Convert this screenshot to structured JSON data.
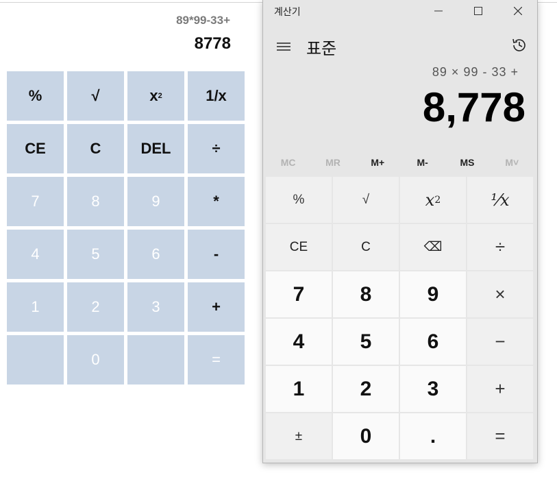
{
  "web_calc": {
    "expression": "89*99-33+",
    "result": "8778",
    "keys": [
      {
        "label": "%",
        "name": "key-percent",
        "type": "op"
      },
      {
        "label": "√",
        "name": "key-sqrt",
        "type": "op"
      },
      {
        "label": "x",
        "sup": "2",
        "name": "key-square",
        "type": "op"
      },
      {
        "label": "1/x",
        "name": "key-reciprocal",
        "type": "op"
      },
      {
        "label": "CE",
        "name": "key-clear-entry",
        "type": "op"
      },
      {
        "label": "C",
        "name": "key-clear",
        "type": "op"
      },
      {
        "label": "DEL",
        "name": "key-delete",
        "type": "op"
      },
      {
        "label": "÷",
        "name": "key-divide",
        "type": "op"
      },
      {
        "label": "7",
        "name": "key-7",
        "type": "num"
      },
      {
        "label": "8",
        "name": "key-8",
        "type": "num"
      },
      {
        "label": "9",
        "name": "key-9",
        "type": "num"
      },
      {
        "label": "*",
        "name": "key-multiply",
        "type": "op"
      },
      {
        "label": "4",
        "name": "key-4",
        "type": "num"
      },
      {
        "label": "5",
        "name": "key-5",
        "type": "num"
      },
      {
        "label": "6",
        "name": "key-6",
        "type": "num"
      },
      {
        "label": "-",
        "name": "key-subtract",
        "type": "op"
      },
      {
        "label": "1",
        "name": "key-1",
        "type": "num"
      },
      {
        "label": "2",
        "name": "key-2",
        "type": "num"
      },
      {
        "label": "3",
        "name": "key-3",
        "type": "num"
      },
      {
        "label": "+",
        "name": "key-add",
        "type": "op"
      },
      {
        "label": "",
        "name": "key-blank-left",
        "type": "num"
      },
      {
        "label": "0",
        "name": "key-0",
        "type": "num"
      },
      {
        "label": "",
        "name": "key-blank-right",
        "type": "num"
      },
      {
        "label": "=",
        "name": "key-equals",
        "type": "num"
      }
    ]
  },
  "win_calc": {
    "window_title": "계산기",
    "mode_title": "표준",
    "expression": "89 × 99 - 33 +",
    "display": "8,778",
    "memory": [
      {
        "label": "MC",
        "enabled": false,
        "name": "memory-clear-button"
      },
      {
        "label": "MR",
        "enabled": false,
        "name": "memory-recall-button"
      },
      {
        "label": "M+",
        "enabled": true,
        "name": "memory-add-button"
      },
      {
        "label": "M-",
        "enabled": true,
        "name": "memory-subtract-button"
      },
      {
        "label": "MS",
        "enabled": true,
        "name": "memory-store-button"
      },
      {
        "label": "M˅",
        "enabled": false,
        "name": "memory-list-button"
      }
    ],
    "keys": [
      {
        "label": "%",
        "name": "win-key-percent",
        "type": "op small"
      },
      {
        "label": "√",
        "name": "win-key-sqrt",
        "type": "op small"
      },
      {
        "label": "x",
        "sup": "2",
        "name": "win-key-square",
        "type": "func"
      },
      {
        "label": "⅟x",
        "name": "win-key-reciprocal",
        "type": "func"
      },
      {
        "label": "CE",
        "name": "win-key-clear-entry",
        "type": "small"
      },
      {
        "label": "C",
        "name": "win-key-clear",
        "type": "small"
      },
      {
        "label": "⌫",
        "name": "win-key-backspace",
        "type": "small"
      },
      {
        "label": "÷",
        "name": "win-key-divide",
        "type": "op"
      },
      {
        "label": "7",
        "name": "win-key-7",
        "type": "num"
      },
      {
        "label": "8",
        "name": "win-key-8",
        "type": "num"
      },
      {
        "label": "9",
        "name": "win-key-9",
        "type": "num"
      },
      {
        "label": "×",
        "name": "win-key-multiply",
        "type": "op"
      },
      {
        "label": "4",
        "name": "win-key-4",
        "type": "num"
      },
      {
        "label": "5",
        "name": "win-key-5",
        "type": "num"
      },
      {
        "label": "6",
        "name": "win-key-6",
        "type": "num"
      },
      {
        "label": "−",
        "name": "win-key-subtract",
        "type": "op"
      },
      {
        "label": "1",
        "name": "win-key-1",
        "type": "num"
      },
      {
        "label": "2",
        "name": "win-key-2",
        "type": "num"
      },
      {
        "label": "3",
        "name": "win-key-3",
        "type": "num"
      },
      {
        "label": "+",
        "name": "win-key-add",
        "type": "op"
      },
      {
        "label": "±",
        "name": "win-key-negate",
        "type": "small"
      },
      {
        "label": "0",
        "name": "win-key-0",
        "type": "num"
      },
      {
        "label": ".",
        "name": "win-key-decimal",
        "type": "num"
      },
      {
        "label": "=",
        "name": "win-key-equals",
        "type": "op"
      }
    ]
  }
}
